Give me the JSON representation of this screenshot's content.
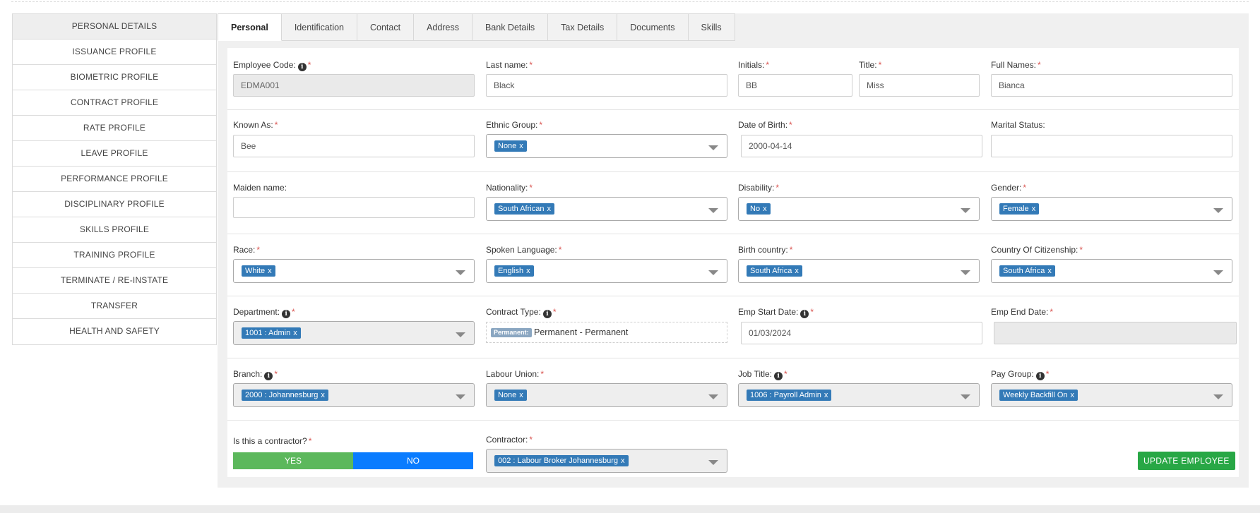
{
  "sidebar": {
    "items": [
      {
        "label": "PERSONAL DETAILS"
      },
      {
        "label": "ISSUANCE PROFILE"
      },
      {
        "label": "BIOMETRIC PROFILE"
      },
      {
        "label": "CONTRACT PROFILE"
      },
      {
        "label": "RATE PROFILE"
      },
      {
        "label": "LEAVE PROFILE"
      },
      {
        "label": "PERFORMANCE PROFILE"
      },
      {
        "label": "DISCIPLINARY PROFILE"
      },
      {
        "label": "SKILLS PROFILE"
      },
      {
        "label": "TRAINING PROFILE"
      },
      {
        "label": "TERMINATE / RE-INSTATE"
      },
      {
        "label": "TRANSFER"
      },
      {
        "label": "HEALTH AND SAFETY"
      }
    ],
    "active_index": 0
  },
  "tabs": [
    {
      "label": "Personal"
    },
    {
      "label": "Identification"
    },
    {
      "label": "Contact"
    },
    {
      "label": "Address"
    },
    {
      "label": "Bank Details"
    },
    {
      "label": "Tax Details"
    },
    {
      "label": "Documents"
    },
    {
      "label": "Skills"
    }
  ],
  "form": {
    "required_mark": "*",
    "info_glyph": "i",
    "remove_glyph": "x",
    "employee_code": {
      "label": "Employee Code:",
      "value": "EDMA001"
    },
    "last_name": {
      "label": "Last name:",
      "value": "Black"
    },
    "initials": {
      "label": "Initials:",
      "value": "BB"
    },
    "title": {
      "label": "Title:",
      "value": "Miss"
    },
    "full_names": {
      "label": "Full Names:",
      "value": "Bianca"
    },
    "known_as": {
      "label": "Known As:",
      "value": "Bee"
    },
    "ethnic_group": {
      "label": "Ethnic Group:",
      "value": "None"
    },
    "date_of_birth": {
      "label": "Date of Birth:",
      "value": "2000-04-14"
    },
    "marital_status": {
      "label": "Marital Status:",
      "value": ""
    },
    "maiden_name": {
      "label": "Maiden name:",
      "value": ""
    },
    "nationality": {
      "label": "Nationality:",
      "value": "South African"
    },
    "disability": {
      "label": "Disability:",
      "value": "No"
    },
    "gender": {
      "label": "Gender:",
      "value": "Female"
    },
    "race": {
      "label": "Race:",
      "value": "White"
    },
    "spoken_language": {
      "label": "Spoken Language:",
      "value": "English"
    },
    "birth_country": {
      "label": "Birth country:",
      "value": "South Africa"
    },
    "citizenship": {
      "label": "Country Of Citizenship:",
      "value": "South Africa"
    },
    "department": {
      "label": "Department:",
      "value": "1001 : Admin"
    },
    "contract_type": {
      "label": "Contract Type:",
      "badge": "Permanent:",
      "value": "Permanent - Permanent"
    },
    "emp_start_date": {
      "label": "Emp Start Date:",
      "value": "01/03/2024"
    },
    "emp_end_date": {
      "label": "Emp End Date:",
      "value": ""
    },
    "branch": {
      "label": "Branch:",
      "value": "2000 : Johannesburg"
    },
    "labour_union": {
      "label": "Labour Union:",
      "value": "None"
    },
    "job_title": {
      "label": "Job Title:",
      "value": "1006 : Payroll Admin"
    },
    "pay_group": {
      "label": "Pay Group:",
      "value": "Weekly Backfill On"
    },
    "is_contractor": {
      "label": "Is this a contractor?",
      "yes_label": "YES",
      "no_label": "NO"
    },
    "contractor": {
      "label": "Contractor:",
      "value": "002 : Labour Broker Johannesburg"
    },
    "update_button": "UPDATE EMPLOYEE"
  },
  "colors": {
    "chip": "#337ab7",
    "toggle_yes": "#5cb85c",
    "toggle_no": "#0a7cff",
    "update_button": "#28a745",
    "required": "#d9534f"
  }
}
